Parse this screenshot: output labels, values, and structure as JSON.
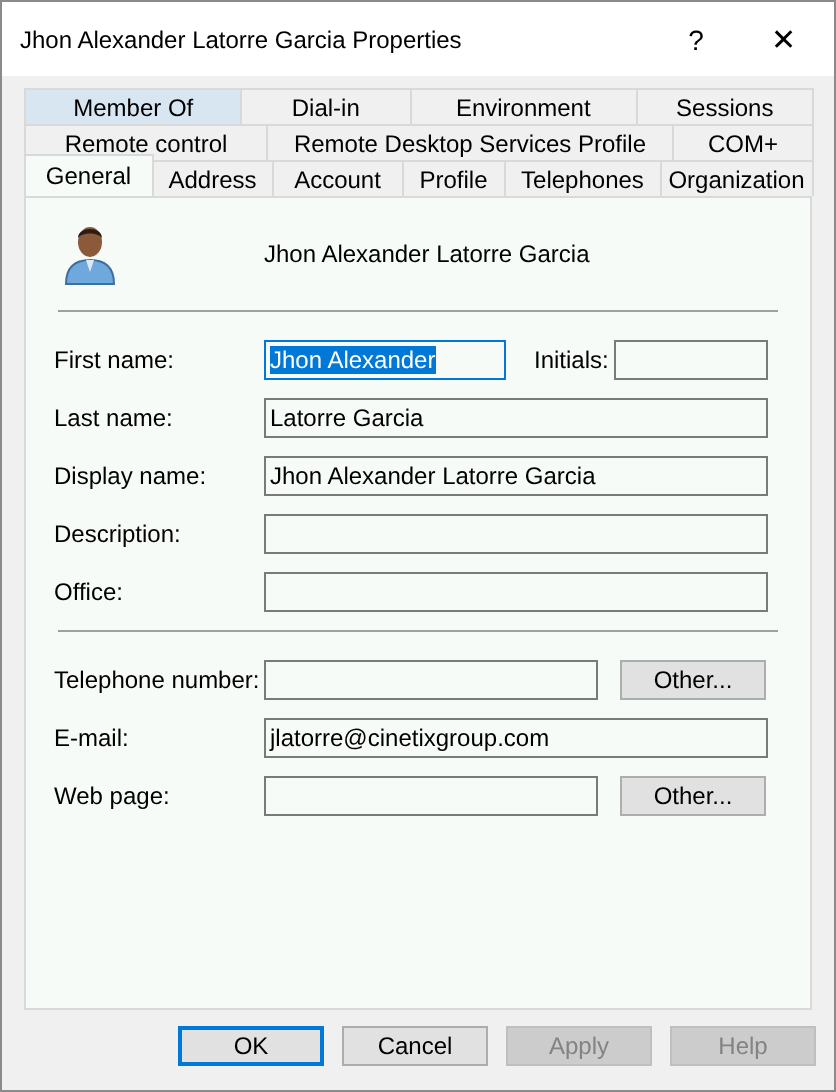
{
  "window": {
    "title": "Jhon Alexander Latorre Garcia Properties",
    "help_glyph": "?",
    "close_glyph": "✕"
  },
  "tab_rows": [
    {
      "tabs": [
        {
          "label": "Member Of",
          "selected": false,
          "hovered": true
        },
        {
          "label": "Dial-in",
          "selected": false,
          "hovered": false
        },
        {
          "label": "Environment",
          "selected": false,
          "hovered": false
        },
        {
          "label": "Sessions",
          "selected": false,
          "hovered": false
        }
      ]
    },
    {
      "tabs": [
        {
          "label": "Remote control",
          "selected": false,
          "hovered": false
        },
        {
          "label": "Remote Desktop Services Profile",
          "selected": false,
          "hovered": false
        },
        {
          "label": "COM+",
          "selected": false,
          "hovered": false
        }
      ]
    },
    {
      "tabs": [
        {
          "label": "General",
          "selected": true,
          "hovered": false
        },
        {
          "label": "Address",
          "selected": false,
          "hovered": false
        },
        {
          "label": "Account",
          "selected": false,
          "hovered": false
        },
        {
          "label": "Profile",
          "selected": false,
          "hovered": false
        },
        {
          "label": "Telephones",
          "selected": false,
          "hovered": false
        },
        {
          "label": "Organization",
          "selected": false,
          "hovered": false
        }
      ]
    }
  ],
  "header": {
    "name": "Jhon Alexander Latorre Garcia"
  },
  "sections": [
    {
      "rows": [
        {
          "kind": "initials",
          "label": "First name:",
          "value": "Jhon Alexander",
          "focused": true,
          "extra_label": "Initials:",
          "extra_value": ""
        },
        {
          "kind": "plain",
          "label": "Last name:",
          "value": "Latorre Garcia",
          "focused": false
        },
        {
          "kind": "plain",
          "label": "Display name:",
          "value": "Jhon Alexander Latorre Garcia",
          "focused": false
        },
        {
          "kind": "plain",
          "label": "Description:",
          "value": "",
          "focused": false
        },
        {
          "kind": "plain",
          "label": "Office:",
          "value": "",
          "focused": false
        }
      ]
    },
    {
      "rows": [
        {
          "kind": "other",
          "label": "Telephone number:",
          "value": "",
          "focused": false,
          "button": "Other..."
        },
        {
          "kind": "plain",
          "label": "E-mail:",
          "value": "jlatorre@cinetixgroup.com",
          "focused": false
        },
        {
          "kind": "other",
          "label": "Web page:",
          "value": "",
          "focused": false,
          "button": "Other..."
        }
      ]
    }
  ],
  "buttons": [
    {
      "label": "OK",
      "default": true,
      "disabled": false
    },
    {
      "label": "Cancel",
      "default": false,
      "disabled": false
    },
    {
      "label": "Apply",
      "default": false,
      "disabled": true
    },
    {
      "label": "Help",
      "default": false,
      "disabled": true
    }
  ]
}
